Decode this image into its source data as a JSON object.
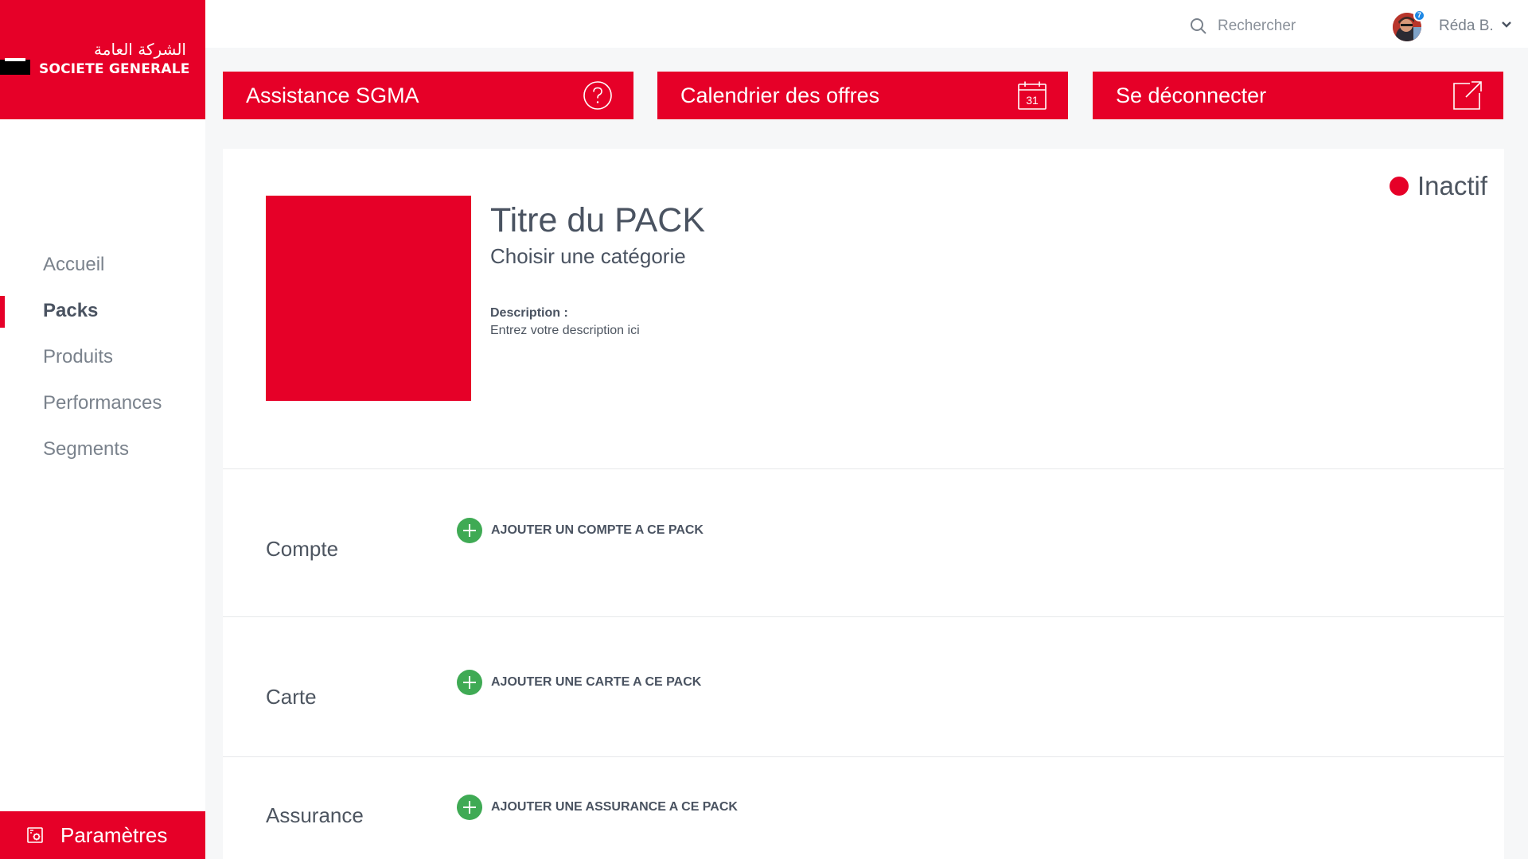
{
  "brand": {
    "arabic_name": "الشركة العامة",
    "latin_name": "SOCIETE GENERALE",
    "primary_color": "#e60028"
  },
  "sidebar": {
    "items": [
      {
        "label": "Accueil",
        "active": false
      },
      {
        "label": "Packs",
        "active": true
      },
      {
        "label": "Produits",
        "active": false
      },
      {
        "label": "Performances",
        "active": false
      },
      {
        "label": "Segments",
        "active": false
      }
    ],
    "settings": {
      "label": "Paramètres",
      "icon": "settings-icon"
    }
  },
  "topbar": {
    "search": {
      "placeholder": "Rechercher",
      "value": "",
      "icon": "search-icon"
    },
    "user": {
      "name": "Réda B.",
      "notification_count": "7"
    }
  },
  "actions": [
    {
      "label": "Assistance SGMA",
      "icon": "help-circle-icon"
    },
    {
      "label": "Calendrier des offres",
      "icon": "calendar-icon",
      "icon_text": "31"
    },
    {
      "label": "Se déconnecter",
      "icon": "external-link-icon"
    }
  ],
  "pack": {
    "status": "Inactif",
    "status_color": "#e60028",
    "title": "Titre du PACK",
    "category": "Choisir une catégorie",
    "description_label": "Description :",
    "description_text": "Entrez votre description ici"
  },
  "sections": [
    {
      "label": "Compte",
      "add_label": "AJOUTER UN COMPTE A CE PACK"
    },
    {
      "label": "Carte",
      "add_label": "AJOUTER UNE CARTE A CE PACK"
    },
    {
      "label": "Assurance",
      "add_label": "AJOUTER UNE ASSURANCE A CE PACK"
    }
  ],
  "colors": {
    "add_green": "#3faa54",
    "text_dark": "#4a5361",
    "nav_muted": "#7a828c"
  }
}
